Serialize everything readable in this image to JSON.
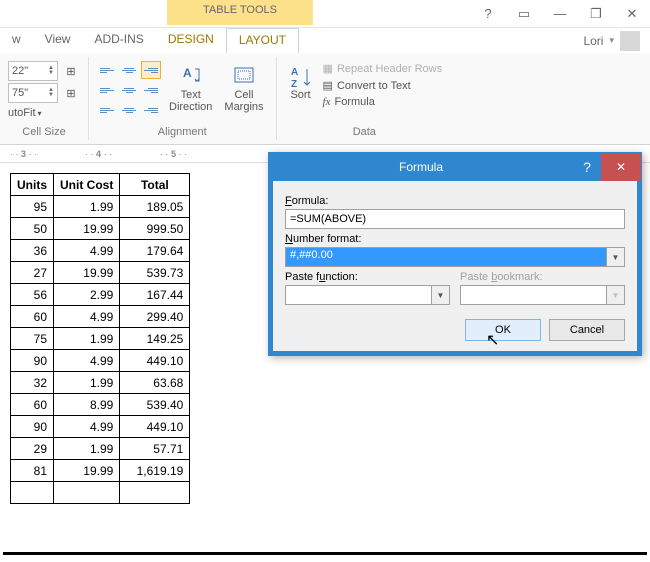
{
  "window": {
    "user": "Lori"
  },
  "context_tab_label": "TABLE TOOLS",
  "tabs": {
    "view_partial": "w",
    "view": "View",
    "addins": "ADD-INS",
    "design": "DESIGN",
    "layout": "LAYOUT"
  },
  "ribbon": {
    "cellsize": {
      "h1": "22\"",
      "h2": "75\"",
      "autofit": "utoFit",
      "label": "Cell Size"
    },
    "alignment": {
      "textdir": "Text\nDirection",
      "cellmarg": "Cell\nMargins",
      "label": "Alignment"
    },
    "data": {
      "sort": "Sort",
      "rhr": "Repeat Header Rows",
      "ctt": "Convert to Text",
      "formula": "Formula",
      "label": "Data"
    }
  },
  "ruler": [
    "3",
    "4",
    "5"
  ],
  "table": {
    "headers": [
      "Units",
      "Unit Cost",
      "Total"
    ],
    "rows": [
      [
        "95",
        "1.99",
        "189.05"
      ],
      [
        "50",
        "19.99",
        "999.50"
      ],
      [
        "36",
        "4.99",
        "179.64"
      ],
      [
        "27",
        "19.99",
        "539.73"
      ],
      [
        "56",
        "2.99",
        "167.44"
      ],
      [
        "60",
        "4.99",
        "299.40"
      ],
      [
        "75",
        "1.99",
        "149.25"
      ],
      [
        "90",
        "4.99",
        "449.10"
      ],
      [
        "32",
        "1.99",
        "63.68"
      ],
      [
        "60",
        "8.99",
        "539.40"
      ],
      [
        "90",
        "4.99",
        "449.10"
      ],
      [
        "29",
        "1.99",
        "57.71"
      ],
      [
        "81",
        "19.99",
        "1,619.19"
      ]
    ]
  },
  "dialog": {
    "title": "Formula",
    "formula_label": "Formula:",
    "formula_value": "=SUM(ABOVE)",
    "numfmt_label": "Number format:",
    "numfmt_value": "#,##0.00",
    "pastefn_label": "Paste function:",
    "pastebk_label": "Paste bookmark:",
    "ok": "OK",
    "cancel": "Cancel"
  }
}
